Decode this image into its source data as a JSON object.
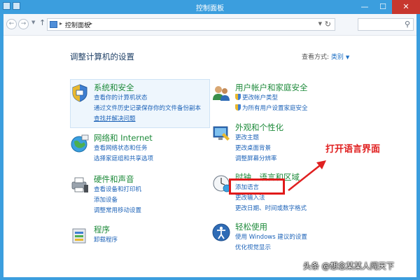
{
  "window": {
    "title": "控制面板"
  },
  "address_bar": {
    "location": "控制面板",
    "separator": "▸",
    "back_glyph": "←",
    "forward_glyph": "→",
    "up_glyph": "↑",
    "refresh_glyph": "↻",
    "search_placeholder": ""
  },
  "header": {
    "title": "调整计算机的设置",
    "view_by_label": "查看方式:",
    "view_by_value": "类别",
    "view_by_caret": "▼"
  },
  "categories": [
    {
      "title": "系统和安全",
      "icon": "shield-pc-icon",
      "links": [
        "查看你的计算机状态",
        "通过文件历史记录保存你的文件备份副本",
        "查找并解决问题"
      ]
    },
    {
      "title": "网络和 Internet",
      "icon": "globe-network-icon",
      "links": [
        "查看网络状态和任务",
        "选择家庭组和共享选项"
      ]
    },
    {
      "title": "硬件和声音",
      "icon": "printer-speaker-icon",
      "links": [
        "查看设备和打印机",
        "添加设备",
        "调整常用移动设置"
      ]
    },
    {
      "title": "程序",
      "icon": "programs-icon",
      "links": [
        "卸载程序"
      ]
    },
    {
      "title": "用户帐户和家庭安全",
      "icon": "users-icon",
      "links": [
        "更改帐户类型",
        "为所有用户设置家庭安全"
      ]
    },
    {
      "title": "外观和个性化",
      "icon": "appearance-icon",
      "links": [
        "更改主题",
        "更改桌面背景",
        "调整屏幕分辨率"
      ]
    },
    {
      "title": "时钟、语言和区域",
      "icon": "clock-globe-icon",
      "links": [
        "添加语言",
        "更改输入法",
        "更改日期、时间或数字格式"
      ]
    },
    {
      "title": "轻松使用",
      "icon": "ease-of-access-icon",
      "links": [
        "使用 Windows 建议的设置",
        "优化视觉显示"
      ]
    }
  ],
  "annotation": {
    "text": "打开语言界面",
    "color": "#e02020"
  },
  "watermark": "头条 @想念某某人闯天下",
  "colors": {
    "title_bar": "#3b9ede",
    "category_title": "#1d8a3a",
    "link": "#1d63b8",
    "close_button": "#c7372f"
  }
}
